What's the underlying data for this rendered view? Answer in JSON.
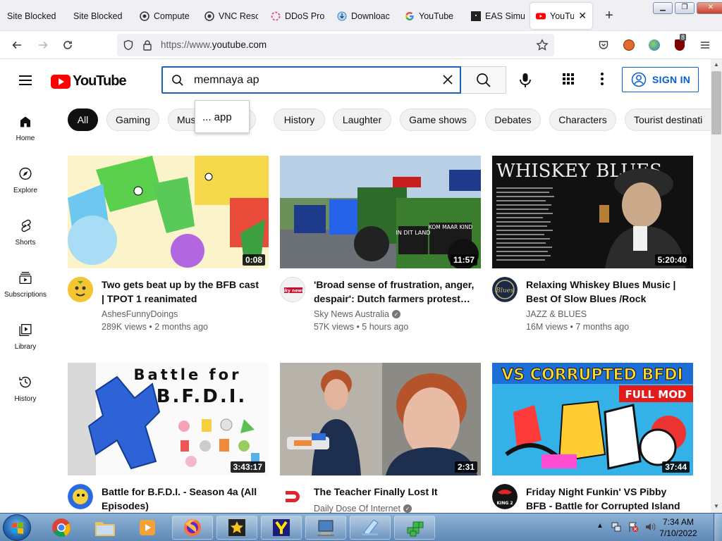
{
  "browser": {
    "tabs": [
      {
        "label": "Site Blocked",
        "icon": "page-icon"
      },
      {
        "label": "Site Blocked",
        "icon": "page-icon"
      },
      {
        "label": "Compute",
        "icon": "github-icon"
      },
      {
        "label": "VNC Resc",
        "icon": "github-icon"
      },
      {
        "label": "DDoS Pro",
        "icon": "ddos-icon"
      },
      {
        "label": "Downloac",
        "icon": "download-icon"
      },
      {
        "label": "YouTube",
        "icon": "google-icon"
      },
      {
        "label": "EAS Simu",
        "icon": "eas-icon"
      },
      {
        "label": "YouTub",
        "icon": "youtube-icon",
        "active": true
      }
    ],
    "url_scheme": "https://www.",
    "url_host": "youtube.com",
    "extension_badge": "8"
  },
  "youtube": {
    "logo_text": "YouTube",
    "search_value": "memnaya ap",
    "suggestion": "... app",
    "signin_label": "SIGN IN",
    "sidebar": [
      {
        "label": "Home",
        "icon": "home-icon"
      },
      {
        "label": "Explore",
        "icon": "compass-icon"
      },
      {
        "label": "Shorts",
        "icon": "shorts-icon"
      },
      {
        "label": "Subscriptions",
        "icon": "subscriptions-icon"
      },
      {
        "label": "Library",
        "icon": "library-icon"
      },
      {
        "label": "History",
        "icon": "history-icon"
      }
    ],
    "chips": [
      "All",
      "Gaming",
      "Music",
      "s",
      "History",
      "Laughter",
      "Game shows",
      "Debates",
      "Characters",
      "Tourist destinati"
    ],
    "videos": [
      {
        "title": "Two gets beat up by the BFB cast | TPOT 1 reanimated",
        "channel": "AshesFunnyDoings",
        "verified": false,
        "views": "289K views",
        "age": "2 months ago",
        "duration": "0:08",
        "meta": "289K views • 2 months ago"
      },
      {
        "title": "'Broad sense of frustration, anger, despair': Dutch farmers protest…",
        "channel": "Sky News Australia",
        "verified": true,
        "views": "57K views",
        "age": "5 hours ago",
        "duration": "11:57",
        "meta": "57K views • 5 hours ago"
      },
      {
        "title": "Relaxing Whiskey Blues Music | Best Of Slow Blues /Rock Ballad…",
        "channel": "JAZZ & BLUES",
        "verified": false,
        "views": "16M views",
        "age": "7 months ago",
        "duration": "5:20:40",
        "meta": "16M views • 7 months ago",
        "thumb_text": "WHISKEY BLUES"
      },
      {
        "title": "Battle for B.F.D.I. - Season 4a (All Episodes)",
        "channel": "",
        "verified": false,
        "duration": "3:43:17",
        "thumb_text_1": "Battle for",
        "thumb_text_2": "B.F.D.I."
      },
      {
        "title": "The Teacher Finally Lost It",
        "channel": "Daily Dose Of Internet",
        "verified": true,
        "duration": "2:31"
      },
      {
        "title": "Friday Night Funkin' VS Pibby BFB - Battle for Corrupted Island |…",
        "channel": "",
        "verified": false,
        "duration": "37:44",
        "thumb_text_1": "VS CORRUPTED BFDI",
        "thumb_text_2": "FULL MOD"
      }
    ],
    "thumb_extra": {
      "sign_text": "IN DIT LAND ZIJN WIJ",
      "sign_text_2": "KOM MAAR KIND NIET MEER WELKOM"
    }
  },
  "taskbar": {
    "time": "7:34 AM",
    "date": "7/10/2022"
  },
  "colors": {
    "yt_red": "#ff0000",
    "link_blue": "#065fd4",
    "search_border": "#1c62b9"
  }
}
